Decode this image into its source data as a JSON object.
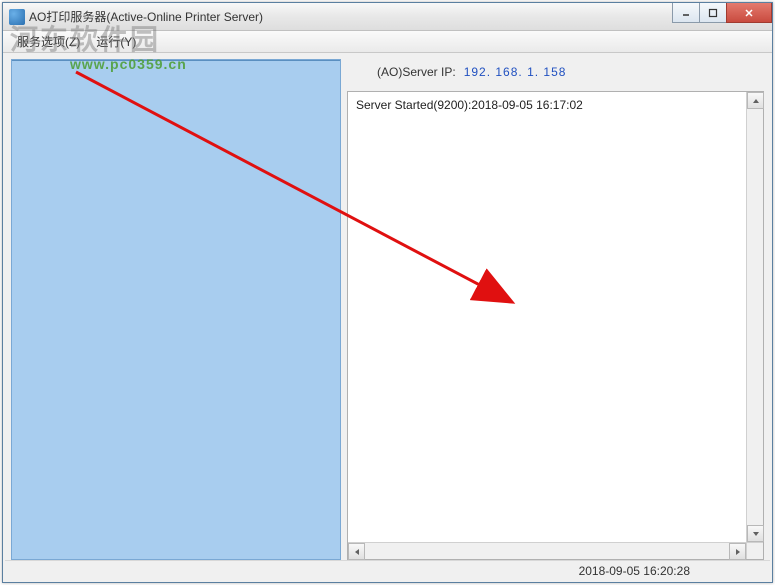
{
  "window": {
    "title": "AO打印服务器(Active-Online Printer Server)"
  },
  "menubar": {
    "items": [
      {
        "label": "服务选项(Z)"
      },
      {
        "label": "运行(Y)"
      }
    ]
  },
  "server": {
    "ip_label": "(AO)Server IP:",
    "ip_value": "192. 168. 1. 158"
  },
  "log": {
    "lines": [
      "Server Started(9200):2018-09-05 16:17:02"
    ]
  },
  "statusbar": {
    "datetime": "2018-09-05 16:20:28"
  },
  "watermark": {
    "cn": "河东软件园",
    "url": "www.pc0359.cn"
  }
}
